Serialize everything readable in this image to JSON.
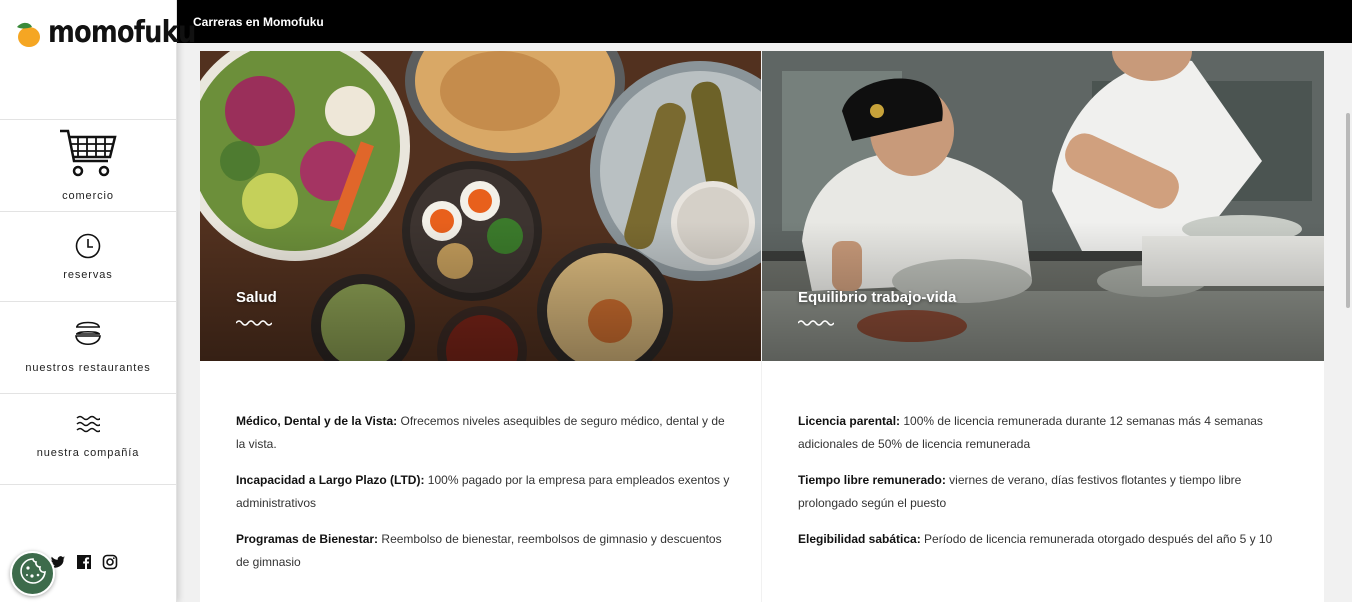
{
  "brand": {
    "name": "momofuku",
    "accent": "#f5a623",
    "leaf": "#3a8a3a"
  },
  "sidebar": {
    "items": [
      {
        "label": "comercio",
        "icon": "shopping-cart-icon"
      },
      {
        "label": "reservas",
        "icon": "clock-icon"
      },
      {
        "label": "nuestros restaurantes",
        "icon": "bowls-icon"
      },
      {
        "label": "nuestra compañía",
        "icon": "waves-icon"
      }
    ],
    "social": [
      "twitter-icon",
      "facebook-icon",
      "instagram-icon"
    ],
    "cookie_icon": "cookie-icon"
  },
  "header": {
    "title": "Carreras en Momofuku"
  },
  "cards": [
    {
      "title": "Salud",
      "benefits": [
        {
          "label": "Médico, Dental y de la Vista:",
          "text": " Ofrecemos niveles asequibles de seguro médico, dental y de la vista."
        },
        {
          "label": "Incapacidad a Largo Plazo (LTD):",
          "text": " 100% pagado por la empresa para empleados exentos y administrativos"
        },
        {
          "label": "Programas de Bienestar:",
          "text": " Reembolso de bienestar, reembolsos de gimnasio y descuentos de gimnasio"
        }
      ]
    },
    {
      "title": "Equilibrio trabajo-vida",
      "benefits": [
        {
          "label": "Licencia parental:",
          "text": " 100% de licencia remunerada durante 12 semanas más 4 semanas adicionales de 50% de licencia remunerada"
        },
        {
          "label": "Tiempo libre remunerado:",
          "text": " viernes de verano, días festivos flotantes y tiempo libre prolongado según el puesto"
        },
        {
          "label": "Elegibilidad sabática:",
          "text": " Período de licencia remunerada otorgado después del año 5 y 10"
        }
      ]
    }
  ]
}
